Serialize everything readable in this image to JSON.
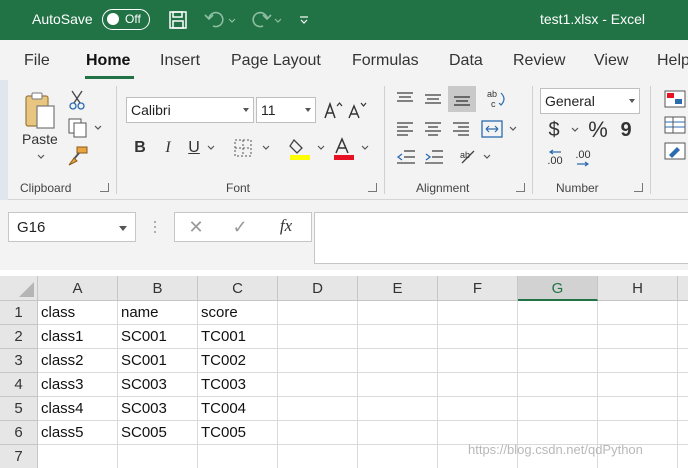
{
  "titlebar": {
    "autosave_label": "AutoSave",
    "autosave_state": "Off",
    "file_title": "test1.xlsx  -  Excel",
    "icons": [
      "save-icon",
      "undo-icon",
      "redo-icon",
      "customize-qat-icon"
    ]
  },
  "tabs": [
    "File",
    "Home",
    "Insert",
    "Page Layout",
    "Formulas",
    "Data",
    "Review",
    "View",
    "Help"
  ],
  "active_tab": "Home",
  "ribbon": {
    "clipboard": {
      "label": "Clipboard",
      "paste_label": "Paste"
    },
    "font": {
      "label": "Font",
      "font_name": "Calibri",
      "font_size": "11",
      "bold": "B",
      "italic": "I",
      "underline": "U"
    },
    "alignment": {
      "label": "Alignment"
    },
    "number": {
      "label": "Number",
      "format": "General",
      "currency": "$",
      "percent": "%",
      "comma": "9",
      "inc_decimal": ".00",
      "dec_decimal": ".00"
    }
  },
  "formula_bar": {
    "name_box": "G16",
    "cancel": "✕",
    "enter": "✓",
    "fx": "fx",
    "value": ""
  },
  "grid": {
    "columns": [
      "A",
      "B",
      "C",
      "D",
      "E",
      "F",
      "G",
      "H"
    ],
    "selected_column": "G",
    "rows": [
      "1",
      "2",
      "3",
      "4",
      "5",
      "6",
      "7"
    ],
    "cells": [
      [
        "class",
        "name",
        "score"
      ],
      [
        "class1",
        "SC001",
        "TC001"
      ],
      [
        "class2",
        "SC001",
        "TC002"
      ],
      [
        "class3",
        "SC003",
        "TC003"
      ],
      [
        "class4",
        "SC003",
        "TC004"
      ],
      [
        "class5",
        "SC005",
        "TC005"
      ],
      [
        "",
        "",
        ""
      ]
    ]
  },
  "watermark": "https://blog.csdn.net/qdPython",
  "colors": {
    "accent": "#217346",
    "font_highlight": "#ffff00",
    "font_color": "#e81123"
  }
}
